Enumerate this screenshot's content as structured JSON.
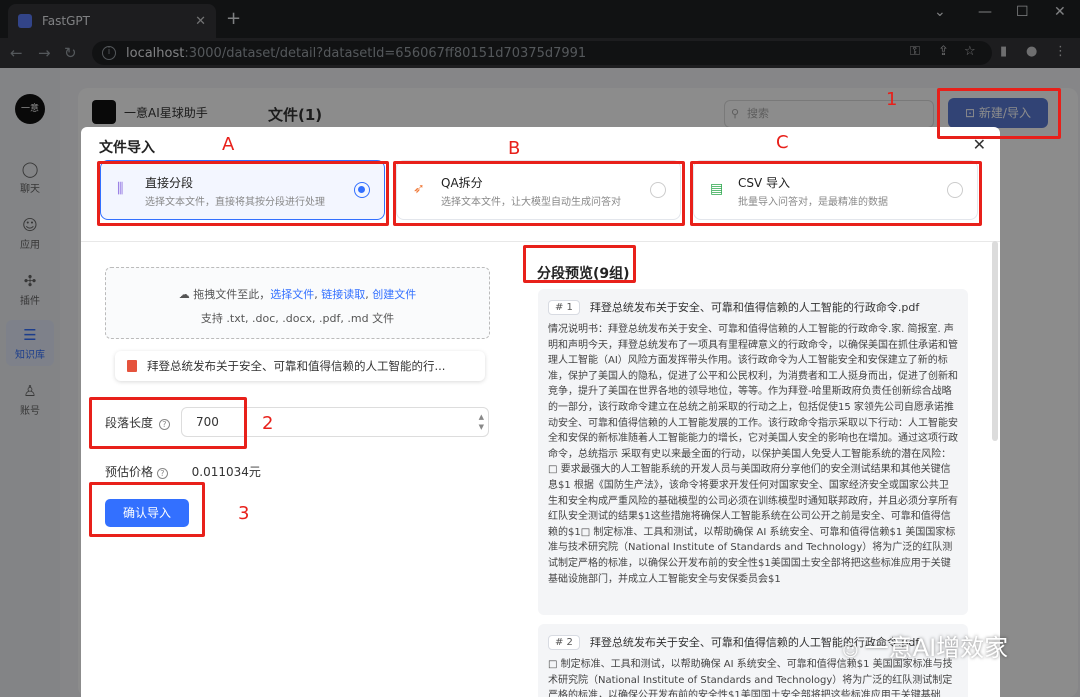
{
  "browser": {
    "tab_title": "FastGPT",
    "new_tab": "+",
    "url_host": "localhost",
    "url_path": ":3000/dataset/detail?datasetId=656067ff80151d70375d7991"
  },
  "sidebar": {
    "avatar_text": "一意",
    "items": [
      {
        "label": "聊天",
        "icon": "chat-icon"
      },
      {
        "label": "应用",
        "icon": "robot-icon"
      },
      {
        "label": "插件",
        "icon": "puzzle-icon"
      },
      {
        "label": "知识库",
        "icon": "database-icon"
      },
      {
        "label": "账号",
        "icon": "user-icon"
      }
    ]
  },
  "dataset": {
    "name": "一意AI星球助手",
    "files_title": "文件(1)",
    "search_placeholder": "搜索",
    "new_import": "新建/导入"
  },
  "modal": {
    "title": "文件导入",
    "options": [
      {
        "name": "直接分段",
        "desc": "选择文本文件，直接将其按分段进行处理",
        "selected": true
      },
      {
        "name": "QA拆分",
        "desc": "选择文本文件，让大模型自动生成问答对",
        "selected": false
      },
      {
        "name": "CSV 导入",
        "desc": "批量导入问答对，是最精准的数据",
        "selected": false
      }
    ],
    "drop": {
      "prefix": "拖拽文件至此，",
      "select": "选择文件",
      "link": "链接读取",
      "create": "创建文件",
      "support": "支持 .txt, .doc, .docx, .pdf, .md 文件"
    },
    "file_name": "拜登总统发布关于安全、可靠和值得信赖的人工智能的行...",
    "length_label": "段落长度",
    "length_value": "700",
    "price_label": "预估价格",
    "price_value": "0.011034元",
    "confirm": "确认导入",
    "preview_title": "分段预览(9组)",
    "chunks": [
      {
        "num": "# 1",
        "title": "拜登总统发布关于安全、可靠和值得信赖的人工智能的行政命令.pdf",
        "body": "情况说明书：拜登总统发布关于安全、可靠和值得信赖的人工智能的行政命令.家. 简报室. 声明和声明今天，拜登总统发布了一项具有里程碑意义的行政命令，以确保美国在抓住承诺和管理人工智能（AI）风险方面发挥带头作用。该行政命令为人工智能安全和安保建立了新的标准，保护了美国人的隐私，促进了公平和公民权利，为消费者和工人挺身而出，促进了创新和竞争，提升了美国在世界各地的领导地位，等等。作为拜登-哈里斯政府负责任创新综合战略的一部分，该行政命令建立在总统之前采取的行动之上，包括促使15 家领先公司自愿承诺推动安全、可靠和值得信赖的人工智能发展的工作。该行政命令指示采取以下行动：人工智能安全和安保的新标准随着人工智能能力的增长，它对美国人安全的影响也在增加。通过这项行政命令，总统指示 采取有史以来最全面的行动，以保护美国人免受人工智能系统的潜在风险：\n□ 要求最强大的人工智能系统的开发人员与美国政府分享他们的安全测试结果和其他关键信息$1 根据《国防生产法》，该命令将要求开发任何对国家安全、国家经济安全或国家公共卫生和安全构成严重风险的基础模型的公司必须在训练模型时通知联邦政府，并且必须分享所有红队安全测试的结果$1这些措施将确保人工智能系统在公司公开之前是安全、可靠和值得信赖的$1□ 制定标准、工具和测试，以帮助确保 AI 系统安全、可靠和值得信赖$1 美国国家标准与技术研究院（National Institute of Standards and Technology）将为广泛的红队测试制定严格的标准，以确保公开发布前的安全性$1美国国土安全部将把这些标准应用于关键基础设施部门，并成立人工智能安全与安保委员会$1"
      },
      {
        "num": "# 2",
        "title": "拜登总统发布关于安全、可靠和值得信赖的人工智能的行政命令.pdf",
        "body": "□ 制定标准、工具和测试，以帮助确保 AI 系统安全、可靠和值得信赖$1 美国国家标准与技术研究院（National Institute of Standards and Technology）将为广泛的红队测试制定严格的标准，以确保公开发布前的安全性$1美国国土安全部将把这些标准应用于关键基础"
      }
    ]
  },
  "annotations": {
    "labels": [
      "A",
      "B",
      "C",
      "1",
      "2",
      "3"
    ],
    "color": "#e8201a"
  },
  "watermark": "一意AI增效家"
}
